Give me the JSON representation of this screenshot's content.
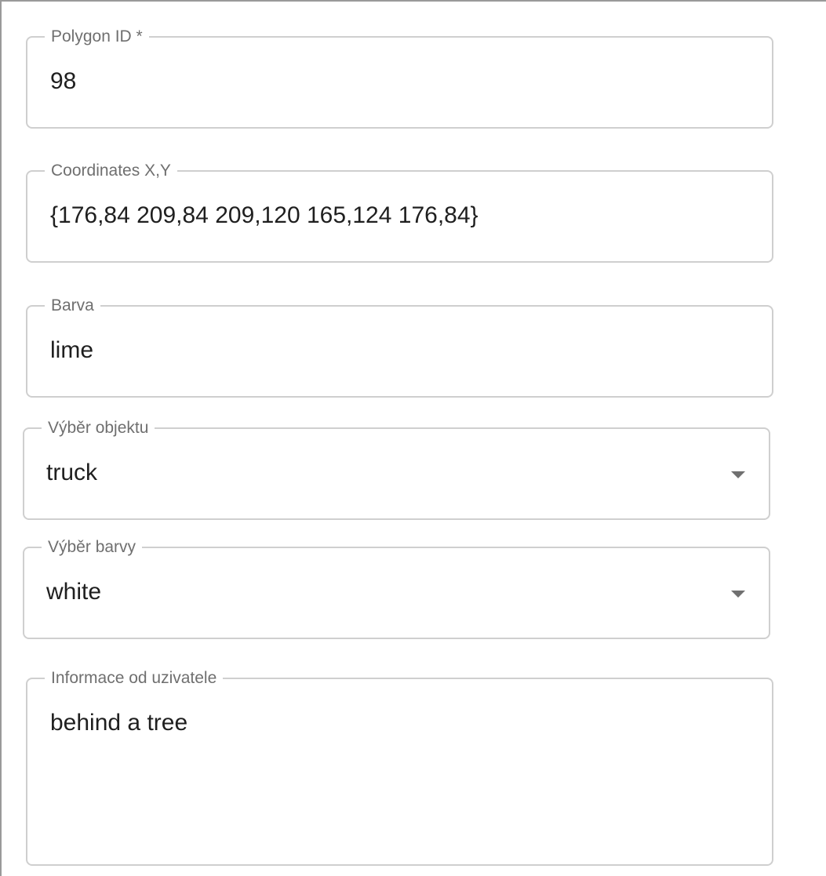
{
  "form": {
    "polygon_id": {
      "label": "Polygon ID *",
      "value": "98"
    },
    "coordinates": {
      "label": "Coordinates X,Y",
      "value": "{176,84 209,84 209,120 165,124 176,84}"
    },
    "barva": {
      "label": "Barva",
      "value": "lime"
    },
    "vyber_objektu": {
      "label": "Výběr objektu",
      "value": "truck",
      "icon": "chevron-down-icon"
    },
    "vyber_barvy": {
      "label": "Výběr barvy",
      "value": "white",
      "icon": "chevron-down-icon"
    },
    "informace": {
      "label": "Informace od uzivatele",
      "value": "behind a tree"
    }
  },
  "colors": {
    "border": "#cfcfcf",
    "label": "#6f6f6f",
    "text": "#1f1f1f",
    "caret": "#707070"
  }
}
